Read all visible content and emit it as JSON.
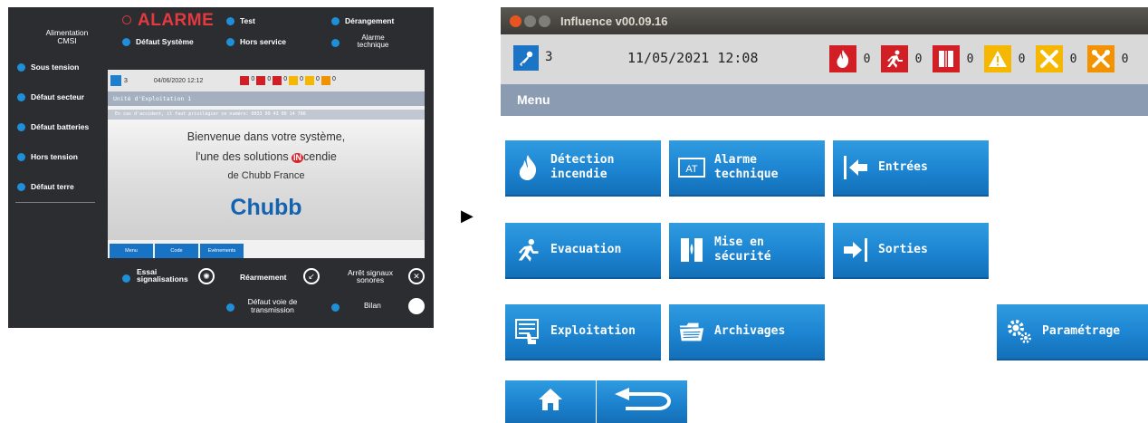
{
  "left_panel": {
    "alarme": "ALARME",
    "top_labels": {
      "test": "Test",
      "derangement": "Dérangement",
      "alimentation": "Alimentation\nCMSI",
      "defaut_systeme": "Défaut Système",
      "hors_service": "Hors service",
      "alarme_technique": "Alarme\ntechnique"
    },
    "side_indicators": [
      "Sous tension",
      "Défaut secteur",
      "Défaut batteries",
      "Hors tension",
      "Défaut terre"
    ],
    "mini_screen": {
      "key_count": "3",
      "date": "04/06/2020 12:12",
      "counters": [
        "0",
        "0",
        "0",
        "0",
        "0",
        "0"
      ],
      "unit": "Unité d'Exploitation 1",
      "info": "En cas d'accident, il faut privilégier ce numéro: 0033 09 43 00 14 786",
      "welcome_line1": "Bienvenue dans votre système,",
      "welcome_line2_before": "l'une des solutions ",
      "welcome_badge": "IN",
      "welcome_line2_after": "cendie",
      "welcome_line3": "de Chubb France",
      "brand": "Chubb",
      "tabs": [
        "Menu",
        "Code",
        "Evènements"
      ]
    },
    "controls": {
      "essai": "Essai\nsignalisations",
      "rearmement": "Réarmement",
      "arret": "Arrêt signaux\nsonores",
      "defaut_voie": "Défaut voie de\ntransmission",
      "bilan": "Bilan"
    }
  },
  "app": {
    "title": "Influence v00.09.16",
    "status": {
      "key_count": "3",
      "datetime": "11/05/2021  12:08",
      "counters": [
        {
          "icon": "fire-icon",
          "value": "0",
          "color": "#d21f26"
        },
        {
          "icon": "running-person-icon",
          "value": "0",
          "color": "#d21f26"
        },
        {
          "icon": "fire-door-icon",
          "value": "0",
          "color": "#d21f26"
        },
        {
          "icon": "warning-triangle-icon",
          "value": "0",
          "color": "#f6b700"
        },
        {
          "icon": "cross-icon",
          "value": "0",
          "color": "#f6b700"
        },
        {
          "icon": "tools-icon",
          "value": "0",
          "color": "#f39200"
        }
      ]
    },
    "menu_title": "Menu",
    "tiles": {
      "detection": "Détection\nincendie",
      "alarme_technique": "Alarme\ntechnique",
      "entrees": "Entrées",
      "evacuation": "Evacuation",
      "mise_securite": "Mise en\nsécurité",
      "sorties": "Sorties",
      "exploitation": "Exploitation",
      "archivages": "Archivages",
      "parametrage": "Paramétrage"
    },
    "at_badge": "AT",
    "accent": "#1c84d1"
  }
}
